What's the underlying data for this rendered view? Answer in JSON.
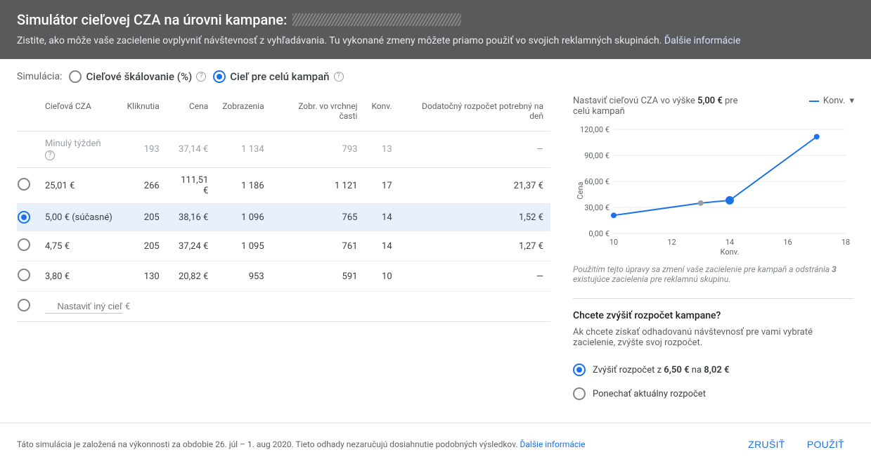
{
  "header": {
    "title_prefix": "Simulátor cieľovej CZA na úrovni kampane:",
    "subtitle": "Zistite, ako môže vaše zacielenie ovplyvniť návštevnosť z vyhľadávania. Tu vykonané zmeny môžete priamo použiť vo svojich reklamných skupinách.",
    "more_info": "Ďalšie informácie"
  },
  "sim": {
    "label": "Simulácia:",
    "opt_scale": "Cieľové škálovanie (%)",
    "opt_whole": "Cieľ pre celú kampaň"
  },
  "table": {
    "headers": {
      "target": "Cieľová CZA",
      "clicks": "Kliknutia",
      "cost": "Cena",
      "impr": "Zobrazenia",
      "top_impr": "Zobr. vo vrchnej časti",
      "conv": "Konv.",
      "extra_budget": "Dodatočný rozpočet potrebný na deň"
    },
    "prev_label": "Minulý týždeň",
    "prev": {
      "clicks": "193",
      "cost": "37,14 €",
      "impr": "1 134",
      "top_impr": "793",
      "conv": "13",
      "extra": "—"
    },
    "rows": [
      {
        "target": "25,01 €",
        "clicks": "266",
        "cost": "111,51 €",
        "impr": "1 186",
        "top_impr": "1 121",
        "conv": "17",
        "extra": "21,37 €",
        "selected": false
      },
      {
        "target": "5,00 € (súčasné)",
        "clicks": "205",
        "cost": "38,16 €",
        "impr": "1 096",
        "top_impr": "765",
        "conv": "14",
        "extra": "1,52 €",
        "selected": true
      },
      {
        "target": "4,75 €",
        "clicks": "205",
        "cost": "37,24 €",
        "impr": "1 095",
        "top_impr": "761",
        "conv": "14",
        "extra": "1,27 €",
        "selected": false
      },
      {
        "target": "3,80 €",
        "clicks": "130",
        "cost": "20,82 €",
        "impr": "953",
        "top_impr": "591",
        "conv": "10",
        "extra": "—",
        "selected": false
      }
    ],
    "custom_placeholder": "Nastaviť iný cieľ",
    "custom_suffix": "€"
  },
  "chart": {
    "title_pre": "Nastaviť cieľovú CZA vo výške ",
    "title_val": "5,00 €",
    "title_post": " pre celú kampaň",
    "legend": "Konv.",
    "ylabel": "Cena",
    "xlabel": "Konv.",
    "y_ticks": [
      "0,00 €",
      "30,00 €",
      "60,00 €",
      "90,00 €",
      "120,00 €"
    ],
    "x_ticks": [
      "10",
      "12",
      "14",
      "16",
      "18"
    ]
  },
  "chart_data": {
    "type": "line",
    "title": "Nastaviť cieľovú CZA vo výške 5,00 € pre celú kampaň",
    "xlabel": "Konv.",
    "ylabel": "Cena",
    "xlim": [
      10,
      18
    ],
    "ylim": [
      0,
      120
    ],
    "series": [
      {
        "name": "Konv.",
        "points": [
          {
            "x": 10,
            "y": 20.82
          },
          {
            "x": 13,
            "y": 35.0,
            "ghost": true
          },
          {
            "x": 14,
            "y": 38.16,
            "highlight": true
          },
          {
            "x": 17,
            "y": 111.51
          }
        ]
      }
    ]
  },
  "note": {
    "pre": "Použitím tejto úpravy sa zmení vaše zacielenie pre kampaň a odstránia ",
    "bold": "3",
    "post": " existujúce zacielenia pre reklamnú skupinu."
  },
  "budget": {
    "heading": "Chcete zvýšiť rozpočet kampane?",
    "desc": "Ak chcete získať odhadovanú návštevnosť pre vami vybraté zacielenie, zvýšte svoj rozpočet.",
    "opt_increase_pre": "Zvýšiť rozpočet z ",
    "opt_increase_from": "6,50 €",
    "opt_increase_mid": " na ",
    "opt_increase_to": "8,02 €",
    "opt_keep": "Ponechať aktuálny rozpočet"
  },
  "footer": {
    "disclaimer": "Táto simulácia je založená na výkonnosti za obdobie 26. júl – 1. aug 2020. Tieto odhady nezaručujú dosiahnutie podobných výsledkov.",
    "more_info": "Ďalšie informácie",
    "cancel": "ZRUŠIŤ",
    "apply": "POUŽIŤ"
  }
}
